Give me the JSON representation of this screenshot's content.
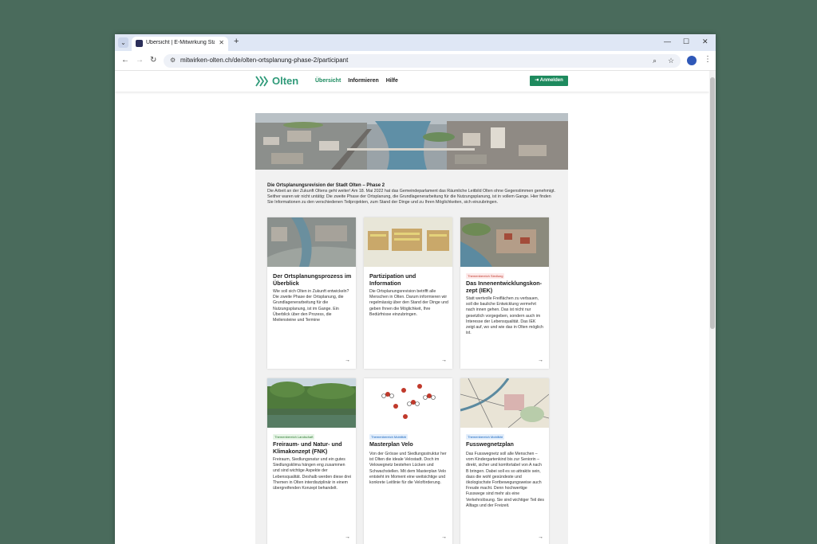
{
  "browser": {
    "tab_title": "Übersicht | E-Mitwirkung Stadt",
    "tab_close": "✕",
    "new_tab": "+",
    "url": "mitwirken-olten.ch/de/olten-ortsplanung-phase-2/participant",
    "win_min": "—",
    "win_max": "☐",
    "win_close": "✕"
  },
  "site": {
    "logo": "Olten",
    "nav": [
      "Übersicht",
      "Informieren",
      "Hilfe"
    ],
    "login": "Anmelden"
  },
  "intro": {
    "title": "Die Ortsplanungsrevision der Stadt Olten – Phase 2",
    "text": "Die Arbeit an der Zukunft Oltens geht weiter! Am 18. Mai 2022 hat das Gemeindeparlament das Räumliche Leitbild Olten ohne Gegenstimmen genehmigt. Seither waren wir nicht untätig: Die zweite Phase der Ortsplanung, die Grundlagenerarbeitung für die Nutzungsplanung, ist in vollem Gange. Hier finden Sie Informationen zu den verschiedenen Teilprojekten, zum Stand der Dinge und zu Ihren Möglichkeiten, sich einzubringen."
  },
  "cards": [
    {
      "badge": "",
      "title": "Der Ortsplanungsprozess im Überblick",
      "text": "Wie soll sich Olten in Zukunft entwickeln? Die zweite Phase der Ortsplanung, die Grundlagenerarbeitung für die Nutzungsplanung, ist im Gange. Ein Überblick über den Prozess, die Meilensteine und Termine"
    },
    {
      "badge": "",
      "title": "Partizipation und Information",
      "text": "Die Ortsplanungsrevision betrifft alle Menschen in Olten. Darum informieren wir regelmässig über den Stand der Dinge und geben Ihnen die Möglichkeit, Ihre Bedürfnisse einzubringen."
    },
    {
      "badge": "Themenbereich Siedlung",
      "title": "Das Innenentwicklungskon­zept (IEK)",
      "text": "Statt wertvolle Freiflächen zu verbauen, soll die bauliche Entwicklung vermehrt nach innen gehen. Das ist nicht nur gesetzlich vorgegeben, sondern auch im Interesse der Lebensqualität. Das IEK zeigt auf, wo und wie das in Olten möglich ist."
    },
    {
      "badge": "Themenbereich Landschaft",
      "title": "Freiraum- und Natur- und Klimakonzept (FNK)",
      "text": "Freiraum, Siedlungsnatur und ein gutes Siedlungsklima hängen eng zusammen und sind wichtige Aspekte der Lebensqualität. Deshalb werden diese drei Themen in Olten interdisziplinär in einem übergreifenden Konzept behandelt."
    },
    {
      "badge": "Themenbereich Mobilität",
      "title": "Masterplan Velo",
      "text": "Von der Grösse und Siedlungsstruktur her ist Olten die ideale Velostadt. Doch im Velowegnetz bestehen Lücken und Schwachstellen. Mit dem Masterplan Velo entsteht im Moment eine weitsichtige und konkrete Leitlinie für die Veloförderung."
    },
    {
      "badge": "Themenbereich Mobilität",
      "title": "Fusswegnetzplan",
      "text": "Das Fusswegnetz soll alle Menschen – vom Kindergartenkind bis zur Seniorin – direkt, sicher und komfortabel von A nach B bringen. Dabei soll es so attraktiv sein, dass die wohl gesündeste und ökologischste Fortbewegungsweise auch Freude macht. Denn hochwertige Fusswege sind mehr als eine Verkehrslösung. Sie sind wichtiger Teil des Alltags und der Freizeit."
    }
  ],
  "arrow": "→",
  "colors": {
    "brand": "#1e8a5e",
    "logo": "#2f9a79",
    "page_bg": "#f1f1f1"
  }
}
